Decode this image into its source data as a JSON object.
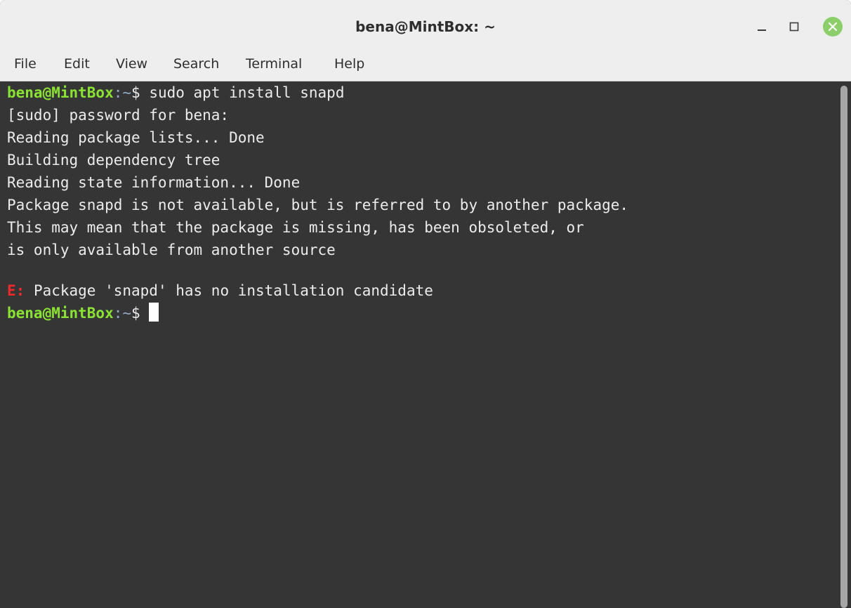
{
  "window": {
    "title": "bena@MintBox: ~"
  },
  "menu": {
    "items": [
      "File",
      "Edit",
      "View",
      "Search",
      "Terminal",
      "Help"
    ]
  },
  "terminal": {
    "prompt_host": "bena@MintBox",
    "prompt_path": ":~",
    "prompt_symbol": "$ ",
    "command": "sudo apt install snapd",
    "output": [
      "[sudo] password for bena:",
      "Reading package lists... Done",
      "Building dependency tree",
      "Reading state information... Done",
      "Package snapd is not available, but is referred to by another package.",
      "This may mean that the package is missing, has been obsoleted, or",
      "is only available from another source"
    ],
    "error_prefix": "E:",
    "error_message": " Package 'snapd' has no installation candidate"
  },
  "colors": {
    "terminal_bg": "#353535",
    "prompt_host": "#8ae234",
    "prompt_path": "#8fa8c8",
    "error": "#ef2929",
    "close_button": "#8ccf6a"
  }
}
